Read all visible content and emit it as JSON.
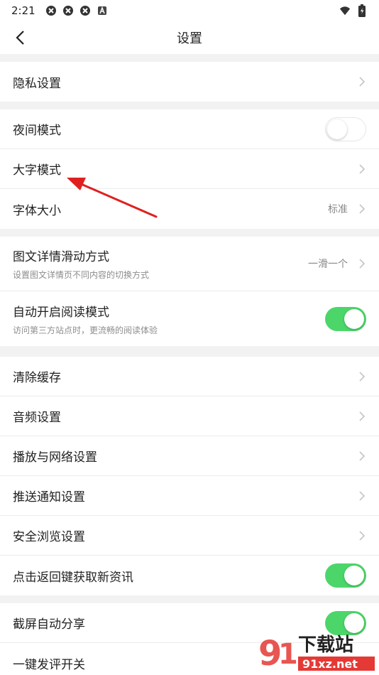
{
  "status": {
    "time": "2:21"
  },
  "nav": {
    "title": "设置"
  },
  "sections": {
    "privacy": {
      "label": "隐私设置"
    },
    "night_mode": {
      "label": "夜间模式"
    },
    "large_font": {
      "label": "大字模式"
    },
    "font_size": {
      "label": "字体大小",
      "value": "标准"
    },
    "slide_mode": {
      "label": "图文详情滑动方式",
      "sub": "设置图文详情页不同内容的切换方式",
      "value": "一滑一个"
    },
    "auto_read": {
      "label": "自动开启阅读模式",
      "sub": "访问第三方站点时，更流畅的阅读体验"
    },
    "clear_cache": {
      "label": "清除缓存"
    },
    "audio": {
      "label": "音频设置"
    },
    "play_network": {
      "label": "播放与网络设置"
    },
    "push": {
      "label": "推送通知设置"
    },
    "safe_browse": {
      "label": "安全浏览设置"
    },
    "back_refresh": {
      "label": "点击返回键获取新资讯"
    },
    "screenshot_share": {
      "label": "截屏自动分享"
    },
    "one_key_comment": {
      "label": "一键发评开关"
    }
  },
  "watermark": {
    "brand": "下载站",
    "domain": "91xz.net"
  },
  "colors": {
    "accent_green": "#4cd66a",
    "arrow_red": "#e02020"
  }
}
